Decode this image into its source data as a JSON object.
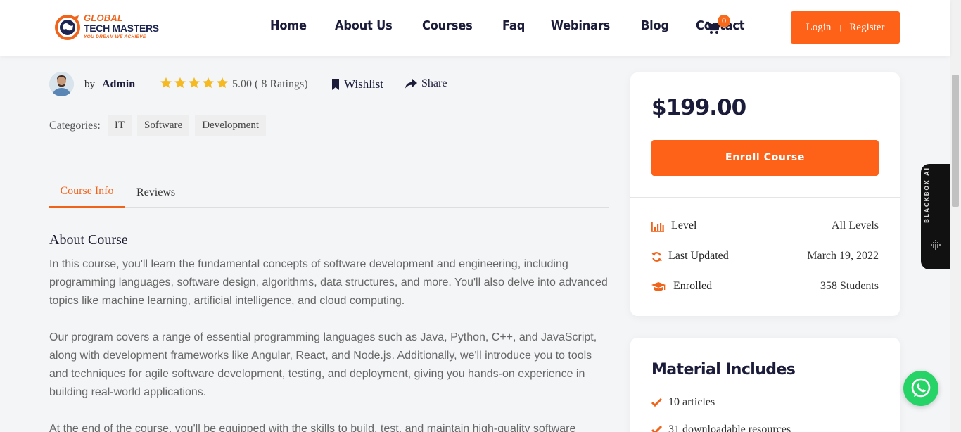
{
  "brand": {
    "line1": "GLOBAL",
    "line2": "TECH MASTERS",
    "tagline": "YOU DREAM WE ACHIEVE",
    "accent": "#f0631b",
    "navy": "#1c2452"
  },
  "nav": {
    "items": [
      "Home",
      "About Us",
      "Courses",
      "Faq",
      "Webinars",
      "Blog",
      "Contact"
    ],
    "cart_count": "0",
    "login": "Login",
    "separator": "|",
    "register": "Register"
  },
  "course_meta": {
    "by": "by",
    "author": "Admin",
    "stars": 5,
    "rating_text": "5.00 ( 8 Ratings)",
    "wishlist": "Wishlist",
    "share": "Share",
    "categories_label": "Categories:",
    "categories": [
      "IT",
      "Software",
      "Development"
    ]
  },
  "tabs": {
    "active": "Course Info",
    "other": "Reviews"
  },
  "about": {
    "heading": "About Course",
    "p1": "In this course, you'll learn the fundamental concepts of software development and engineering, including programming languages, software design, algorithms, data structures, and more. You'll also delve into advanced topics like machine learning, artificial intelligence, and cloud computing.",
    "p2": "Our program covers a range of essential programming languages such as Java, Python, C++, and JavaScript, along with development frameworks like Angular, React, and Node.js. Additionally, we'll introduce you to tools and techniques for agile software development, testing, and deployment, giving you hands-on experience in building real-world applications.",
    "p3": "At the end of the course, you'll be equipped with the skills to build, test, and maintain high-quality software"
  },
  "pricing": {
    "price": "$199.00",
    "enroll": "Enroll Course",
    "info": [
      {
        "icon": "bar-chart-icon",
        "label": "Level",
        "value": "All Levels"
      },
      {
        "icon": "refresh-icon",
        "label": "Last Updated",
        "value": "March 19, 2022"
      },
      {
        "icon": "graduation-cap-icon",
        "label": "Enrolled",
        "value": "358 Students"
      }
    ]
  },
  "materials": {
    "heading": "Material Includes",
    "items": [
      "10 articles",
      "31 downloadable resources"
    ]
  },
  "widget": {
    "label": "BLACKBOX AI"
  }
}
